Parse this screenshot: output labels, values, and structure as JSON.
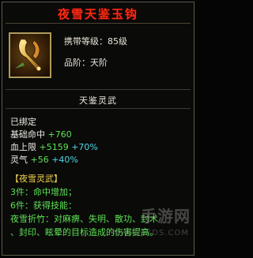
{
  "title": "夜雪天鉴玉钩",
  "carry_level": "携带等级：85级",
  "quality": "品阶：天阶",
  "item_name": "天鉴灵武",
  "bound_status": "已绑定",
  "stats": {
    "base_hit_label": "基础命中",
    "base_hit_value": "+760",
    "hp_label": "血上限",
    "hp_value": "+5159",
    "hp_bonus": "+70%",
    "spirit_label": "灵气",
    "spirit_value": "+56",
    "spirit_bonus": "+40%"
  },
  "set": {
    "name": "【夜雪灵武】",
    "piece3": "3件：命中增加；",
    "piece6": "6件：获得技能：",
    "skill_line1": "夜雪折竹：对麻痹、失明、散功、封术",
    "skill_line2": "、封印、眩晕的目标造成的伤害提高。"
  },
  "watermark": {
    "text": "手游网",
    "sub": "WWW.SXDS.COM"
  },
  "colors": {
    "title": "#ff2a14",
    "green": "#5de254",
    "cyan": "#4fd7e6",
    "yellow": "#f0d24a"
  }
}
